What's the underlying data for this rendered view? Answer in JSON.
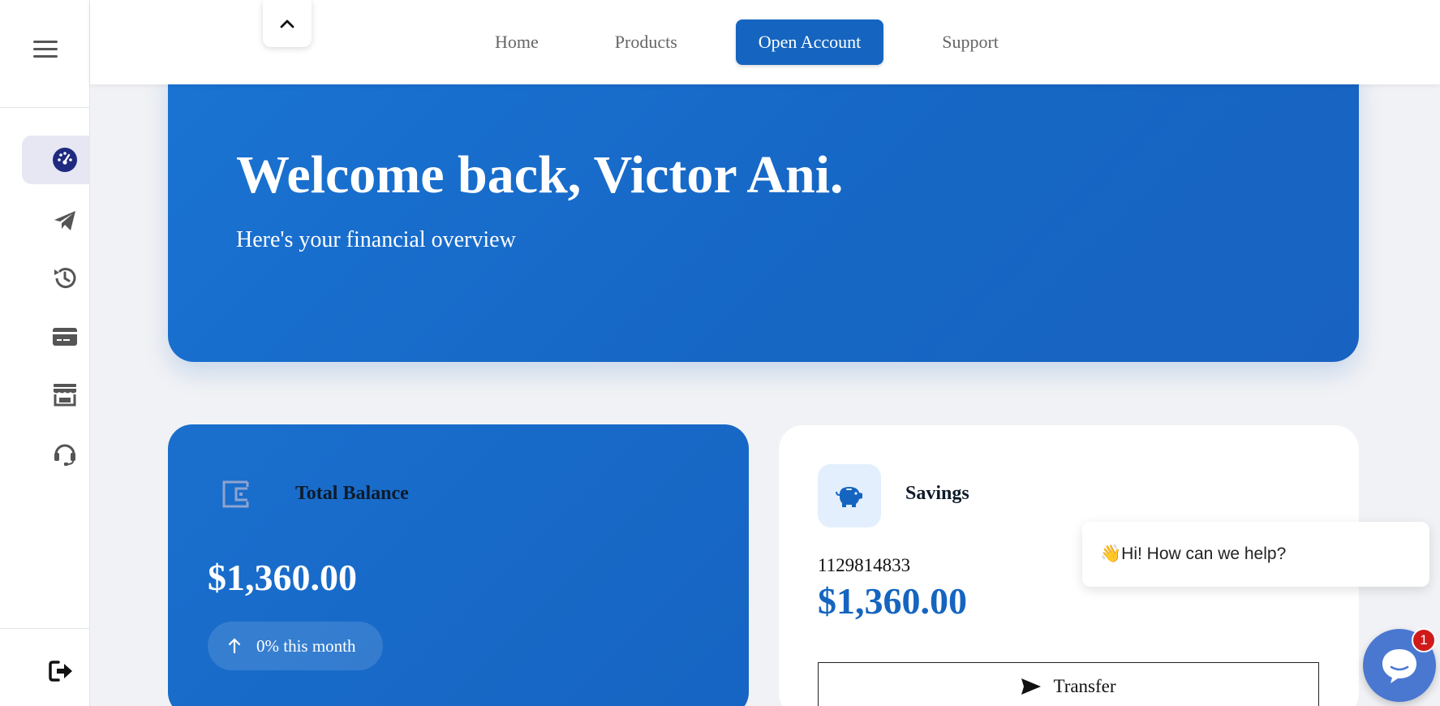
{
  "topnav": {
    "items": [
      {
        "label": "Home"
      },
      {
        "label": "Products"
      },
      {
        "label": "Open Account"
      },
      {
        "label": "Support"
      }
    ]
  },
  "sidebar": {
    "items": [
      {
        "icon": "dashboard-icon",
        "active": true
      },
      {
        "icon": "send-icon",
        "active": false
      },
      {
        "icon": "history-icon",
        "active": false
      },
      {
        "icon": "card-icon",
        "active": false
      },
      {
        "icon": "store-icon",
        "active": false
      },
      {
        "icon": "support-headset-icon",
        "active": false
      }
    ],
    "logout_icon": "logout-icon"
  },
  "hero": {
    "heading": "Welcome back, Victor Ani.",
    "subheading": "Here's your financial overview"
  },
  "balance_card": {
    "title": "Total Balance",
    "amount": "$1,360.00",
    "change": "0% this month"
  },
  "savings_card": {
    "title": "Savings",
    "account_number": "1129814833",
    "amount": "$1,360.00",
    "transfer_label": "Transfer"
  },
  "chat": {
    "greeting_emoji": "👋",
    "greeting": "Hi! How can we help?",
    "badge": "1"
  },
  "colors": {
    "primary": "#1565c0",
    "accent_light": "#e3effc",
    "badge": "#d01a1a",
    "chat": "#4a78d1"
  }
}
